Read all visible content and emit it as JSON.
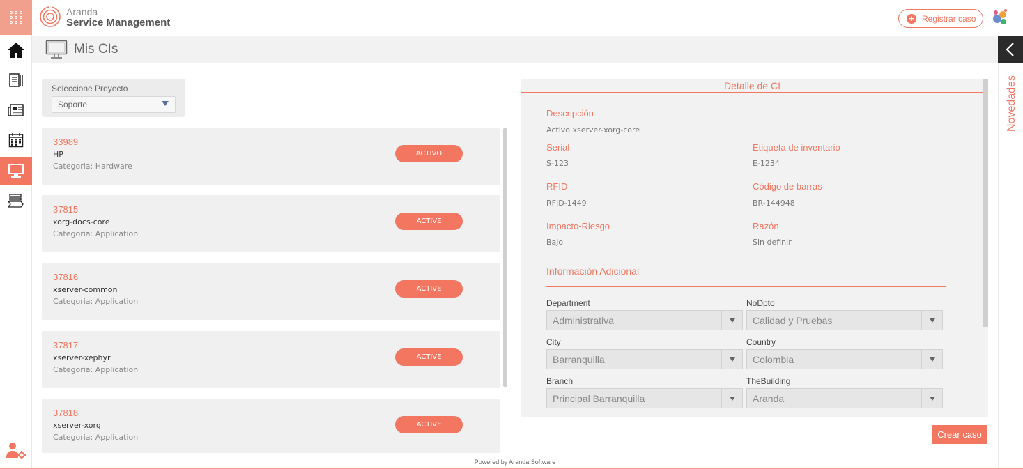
{
  "header": {
    "brand_top": "Aranda",
    "brand_main": "Service Management",
    "register_button": "Registrar caso"
  },
  "page": {
    "title": "Mis CIs"
  },
  "side_panel": {
    "label": "Novedades"
  },
  "project": {
    "label": "Seleccione Proyecto",
    "selected": "Soporte"
  },
  "ci_list": [
    {
      "id": "33989",
      "name": "HP",
      "category": "Categoria: Hardware",
      "status": "ACTIVO"
    },
    {
      "id": "37815",
      "name": "xorg-docs-core",
      "category": "Categoria: Application",
      "status": "ACTIVE"
    },
    {
      "id": "37816",
      "name": "xserver-common",
      "category": "Categoria: Application",
      "status": "ACTIVE"
    },
    {
      "id": "37817",
      "name": "xserver-xephyr",
      "category": "Categoria: Application",
      "status": "ACTIVE"
    },
    {
      "id": "37818",
      "name": "xserver-xorg",
      "category": "Categoria: Application",
      "status": "ACTIVE"
    }
  ],
  "detail": {
    "title": "Detalle de CI",
    "fields": {
      "descripcion": {
        "label": "Descripción",
        "value": "Activo xserver-xorg-core"
      },
      "serial": {
        "label": "Serial",
        "value": "S-123"
      },
      "etiqueta": {
        "label": "Etiqueta de inventario",
        "value": "E-1234"
      },
      "rfid": {
        "label": "RFID",
        "value": "RFID-1449"
      },
      "codigo": {
        "label": "Código de barras",
        "value": "BR-144948"
      },
      "impacto": {
        "label": "Impacto-Riesgo",
        "value": "Bajo"
      },
      "razon": {
        "label": "Razón",
        "value": "Sin definir"
      }
    },
    "additional_title": "Información Adicional",
    "selects": {
      "department": {
        "label": "Department",
        "value": "Administrativa"
      },
      "nodpto": {
        "label": "NoDpto",
        "value": "Calidad y Pruebas"
      },
      "city": {
        "label": "City",
        "value": "Barranquilla"
      },
      "country": {
        "label": "Country",
        "value": "Colombia"
      },
      "branch": {
        "label": "Branch",
        "value": "Principal Barranquilla"
      },
      "building": {
        "label": "TheBuilding",
        "value": "Aranda"
      }
    }
  },
  "actions": {
    "create_case": "Crear caso"
  },
  "footer": {
    "text": "Powered by Aranda Software"
  },
  "colors": {
    "accent": "#f27660",
    "accent_light": "#f2a08e",
    "panel_bg": "#f2f2f2",
    "dark_toggle": "#2b2b2b"
  },
  "icons": {
    "sidebar": [
      "apps-grid-icon",
      "home-icon",
      "document-list-icon",
      "news-icon",
      "calendar-icon",
      "monitor-icon",
      "stack-icon",
      "user-settings-icon"
    ]
  }
}
